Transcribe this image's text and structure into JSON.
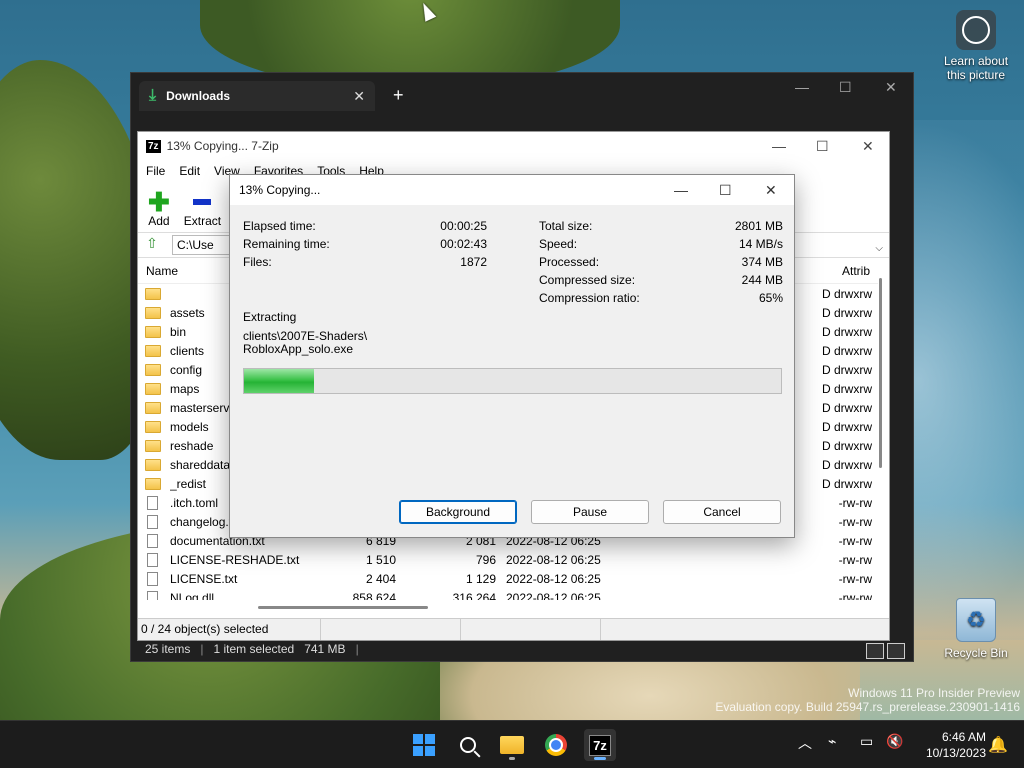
{
  "desktop": {
    "learn_label": "Learn about this picture",
    "recycle_label": "Recycle Bin",
    "watermark_line1": "Windows 11 Pro Insider Preview",
    "watermark_line2": "Evaluation copy. Build 25947.rs_prerelease.230901-1416"
  },
  "explorer": {
    "tab_title": "Downloads",
    "status_items": "25 items",
    "status_selected": "1 item selected",
    "status_size": "741 MB"
  },
  "zip": {
    "title": "13% Copying... 7-Zip",
    "logo": "7z",
    "menu": [
      "File",
      "Edit",
      "View",
      "Favorites",
      "Tools",
      "Help"
    ],
    "toolbar": {
      "add": "Add",
      "extract": "Extract"
    },
    "path": "C:\\Use",
    "columns": {
      "name": "Name",
      "attrib": "Attrib"
    },
    "rows": [
      {
        "name": "",
        "type": "folder",
        "size": "",
        "packed": "",
        "date": "",
        "attrib": "D drwxrw"
      },
      {
        "name": "assets",
        "type": "folder",
        "size": "",
        "packed": "",
        "date": "",
        "attrib": "D drwxrw"
      },
      {
        "name": "bin",
        "type": "folder",
        "size": "",
        "packed": "",
        "date": "",
        "attrib": "D drwxrw"
      },
      {
        "name": "clients",
        "type": "folder",
        "size": "",
        "packed": "",
        "date": "",
        "attrib": "D drwxrw"
      },
      {
        "name": "config",
        "type": "folder",
        "size": "",
        "packed": "",
        "date": "",
        "attrib": "D drwxrw"
      },
      {
        "name": "maps",
        "type": "folder",
        "size": "",
        "packed": "",
        "date": "",
        "attrib": "D drwxrw"
      },
      {
        "name": "masterserver",
        "type": "folder",
        "size": "",
        "packed": "",
        "date": "",
        "attrib": "D drwxrw"
      },
      {
        "name": "models",
        "type": "folder",
        "size": "",
        "packed": "",
        "date": "",
        "attrib": "D drwxrw"
      },
      {
        "name": "reshade",
        "type": "folder",
        "size": "",
        "packed": "",
        "date": "",
        "attrib": "D drwxrw"
      },
      {
        "name": "shareddata",
        "type": "folder",
        "size": "",
        "packed": "",
        "date": "",
        "attrib": "D drwxrw"
      },
      {
        "name": "_redist",
        "type": "folder",
        "size": "",
        "packed": "",
        "date": "",
        "attrib": "D drwxrw"
      },
      {
        "name": ".itch.toml",
        "type": "file",
        "size": "",
        "packed": "",
        "date": "",
        "attrib": "-rw-rw"
      },
      {
        "name": "changelog.tx",
        "type": "file",
        "size": "",
        "packed": "",
        "date": "",
        "attrib": "-rw-rw"
      },
      {
        "name": "documentation.txt",
        "type": "file",
        "size": "6 819",
        "packed": "2 081",
        "date": "2022-08-12 06:25",
        "attrib": "-rw-rw"
      },
      {
        "name": "LICENSE-RESHADE.txt",
        "type": "file",
        "size": "1 510",
        "packed": "796",
        "date": "2022-08-12 06:25",
        "attrib": "-rw-rw"
      },
      {
        "name": "LICENSE.txt",
        "type": "file",
        "size": "2 404",
        "packed": "1 129",
        "date": "2022-08-12 06:25",
        "attrib": "-rw-rw"
      },
      {
        "name": "NLog.dll",
        "type": "file",
        "size": "858 624",
        "packed": "316 264",
        "date": "2022-08-12 06:25",
        "attrib": "-rw-rw"
      }
    ],
    "status": "0 / 24 object(s) selected"
  },
  "dialog": {
    "title": "13% Copying...",
    "elapsed_label": "Elapsed time:",
    "elapsed": "00:00:25",
    "remaining_label": "Remaining time:",
    "remaining": "00:02:43",
    "files_label": "Files:",
    "files": "1872",
    "total_label": "Total size:",
    "total": "2801 MB",
    "speed_label": "Speed:",
    "speed": "14 MB/s",
    "processed_label": "Processed:",
    "processed": "374 MB",
    "compressed_label": "Compressed size:",
    "compressed": "244 MB",
    "ratio_label": "Compression ratio:",
    "ratio": "65%",
    "extracting_label": "Extracting",
    "path_line1": "clients\\2007E-Shaders\\",
    "path_line2": "RobloxApp_solo.exe",
    "progress_fraction": 0.13,
    "buttons": {
      "background": "Background",
      "pause": "Pause",
      "cancel": "Cancel"
    }
  },
  "taskbar": {
    "apps": [
      "start-icon",
      "search-icon",
      "file-explorer-icon",
      "chrome-icon",
      "7zip-icon"
    ],
    "seven_z": "7z",
    "time": "6:46 AM",
    "date": "10/13/2023"
  }
}
